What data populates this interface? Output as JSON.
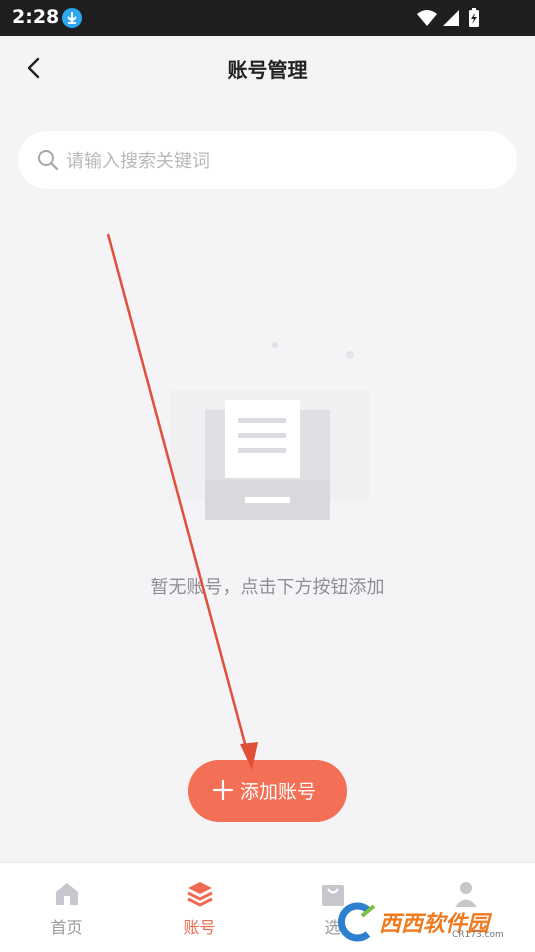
{
  "status_bar": {
    "time": "2:28"
  },
  "nav": {
    "title": "账号管理"
  },
  "search": {
    "placeholder": "请输入搜索关键词"
  },
  "empty_state": {
    "message": "暂无账号，点击下方按钮添加"
  },
  "add_button": {
    "label": "添加账号"
  },
  "tabs": [
    {
      "label": "首页",
      "icon": "home-icon",
      "active": false
    },
    {
      "label": "账号",
      "icon": "layers-icon",
      "active": true
    },
    {
      "label": "选",
      "icon": "bag-icon",
      "active": false
    },
    {
      "label": "",
      "icon": "user-icon",
      "active": false
    }
  ],
  "watermark": {
    "text": "西西软件园",
    "sub": "CR173.com"
  },
  "colors": {
    "accent": "#f36f55",
    "active_tab": "#ef6b4f",
    "background": "#f4f4f6"
  }
}
